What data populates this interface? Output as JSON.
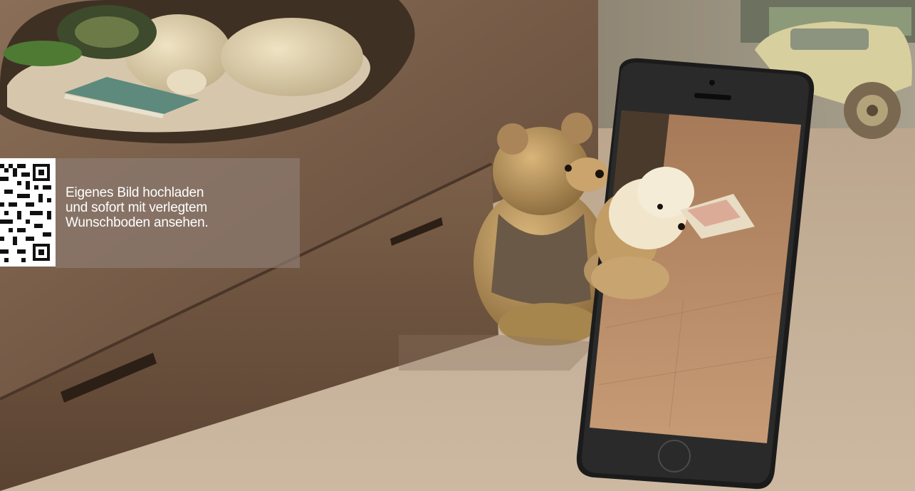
{
  "callout": {
    "line1": "Eigenes Bild hochladen",
    "line2": "und sofort mit verlegtem",
    "line3": "Wunschboden ansehen."
  },
  "icons": {
    "qr_code": "qr-code-icon",
    "smartphone": "smartphone-icon"
  },
  "colors": {
    "callout_background": "#8c7a70",
    "callout_text": "#ffffff",
    "floor": "#c9b39a",
    "bed": "#7a5e48",
    "phone_body": "#1b1b1b"
  }
}
